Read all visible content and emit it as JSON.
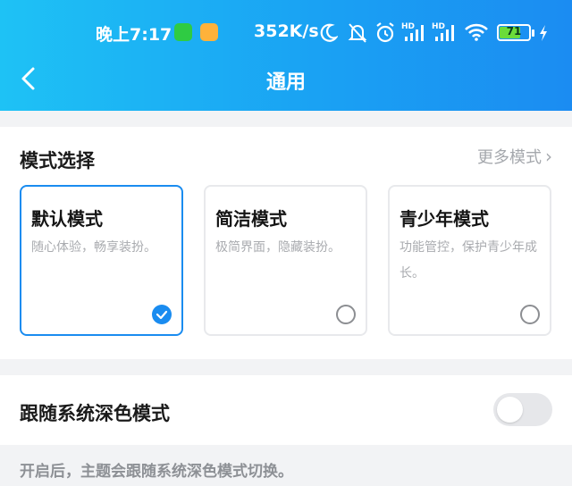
{
  "status_bar": {
    "time": "晚上7:17",
    "speed": "352K/s",
    "battery": "71",
    "battery_level": 0.71,
    "icons": [
      "wechat-icon",
      "note-app-icon",
      "moon-icon",
      "mute-bell-icon",
      "alarm-icon",
      "signal-hd-icon",
      "signal-hd-icon",
      "wifi-icon",
      "battery-icon",
      "charging-icon"
    ]
  },
  "header": {
    "title": "通用",
    "back_icon": "chevron-left-icon"
  },
  "mode_section": {
    "title": "模式选择",
    "more_label": "更多模式",
    "modes": [
      {
        "name": "默认模式",
        "desc": "随心体验，畅享装扮。",
        "selected": true
      },
      {
        "name": "简洁模式",
        "desc": "极简界面，隐藏装扮。",
        "selected": false
      },
      {
        "name": "青少年模式",
        "desc": "功能管控，保护青少年成长。",
        "selected": false
      }
    ]
  },
  "dark_mode": {
    "label": "跟随系统深色模式",
    "enabled": false,
    "hint": "开启后，主题会跟随系统深色模式切换。"
  },
  "colors": {
    "accent": "#1a8cf0",
    "header_start": "#1ec2f5",
    "header_end": "#1b8cf2"
  }
}
